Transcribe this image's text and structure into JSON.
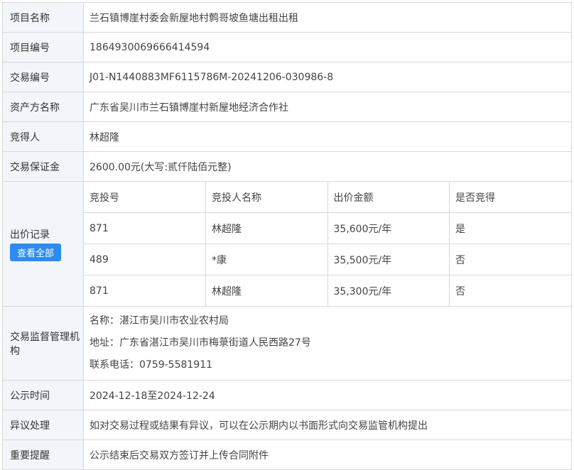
{
  "rows": {
    "project_name": {
      "label": "项目名称",
      "value": "兰石镇博崖村委会新屋地村鹩哥坡鱼塘出租出租"
    },
    "project_no": {
      "label": "项目编号",
      "value": "1864930069666414594"
    },
    "trade_no": {
      "label": "交易编号",
      "value": "J01-N1440883MF6115786M-20241206-030986-8"
    },
    "asset_owner": {
      "label": "资产方名称",
      "value": "广东省吴川市兰石镇博崖村新屋地经济合作社"
    },
    "winner": {
      "label": "竞得人",
      "value": "林超隆"
    },
    "deposit": {
      "label": "交易保证金",
      "value": "2600.00元(大写:贰仟陆佰元整)"
    }
  },
  "bid_record": {
    "label": "出价记录",
    "view_all": "查看全部",
    "headers": [
      "竞投号",
      "竞投人名称",
      "出价金额",
      "是否竞得"
    ],
    "rows": [
      [
        "871",
        "林超隆",
        "35,600元/年",
        "是"
      ],
      [
        "489",
        "*康",
        "35,500元/年",
        "否"
      ],
      [
        "871",
        "林超隆",
        "35,300元/年",
        "否"
      ]
    ]
  },
  "supervisor": {
    "label": "交易监督管理机构",
    "name": "名称：湛江市吴川市农业农村局",
    "address": "地址：广东省湛江市吴川市梅菉街道人民西路27号",
    "phone": "联系电话：0759-5581911"
  },
  "notice_period": {
    "label": "公示时间",
    "value": "2024-12-18至2024-12-24"
  },
  "objection": {
    "label": "异议处理",
    "value": "如对交易过程或结果有异议，可以在公示期内以书面形式向交易监管机构提出"
  },
  "reminder": {
    "label": "重要提醒",
    "value": "公示结束后交易双方签订并上传合同附件"
  }
}
